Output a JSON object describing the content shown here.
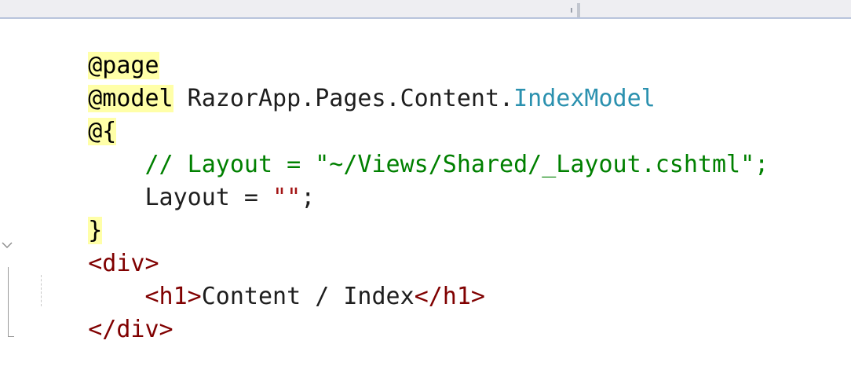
{
  "editor": {
    "lines": [
      {
        "razor": "@page"
      },
      {
        "razor": "@model",
        "text": " RazorApp.Pages.Content.",
        "type": "IndexModel"
      },
      {
        "razor": "@{"
      },
      {
        "indent": "    ",
        "comment": "// Layout = \"~/Views/Shared/_Layout.cshtml\";"
      },
      {
        "indent": "    ",
        "text": "Layout = ",
        "string": "\"\"",
        "text2": ";"
      },
      {
        "razor": "}"
      },
      {
        "open_tag": "<div>"
      },
      {
        "indent": "    ",
        "open_tag": "<h1>",
        "text": "Content / Index",
        "close_tag": "</h1>"
      },
      {
        "close_tag": "</div>"
      }
    ]
  },
  "icons": {
    "fold": "collapse-chevron-icon"
  },
  "colors": {
    "razor_highlight": "#ffffa8",
    "type": "#2b91af",
    "comment": "#008000",
    "string": "#a31515",
    "tag": "#800000",
    "text": "#1e1e1e"
  }
}
